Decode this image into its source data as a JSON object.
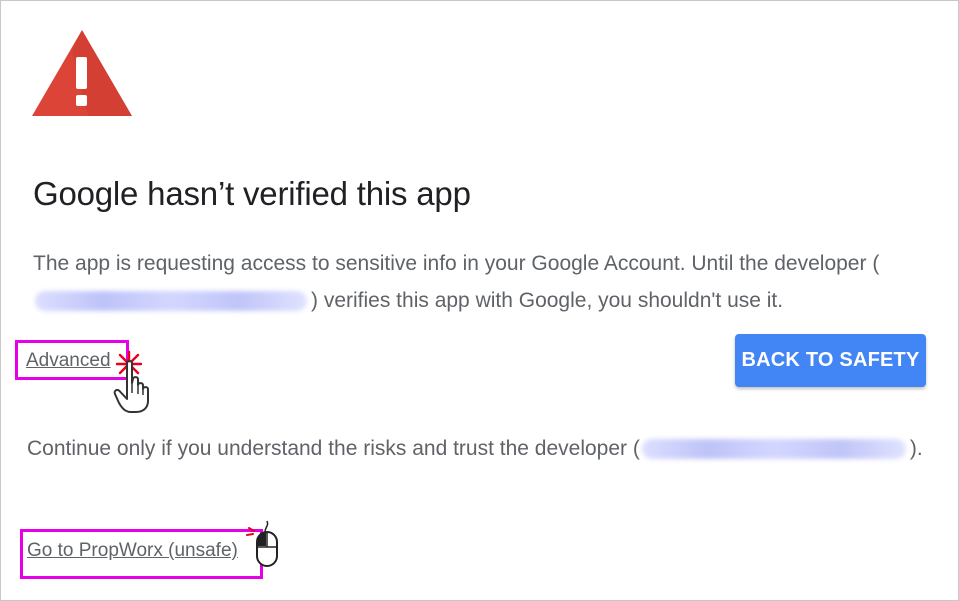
{
  "dialog": {
    "title": "Google hasn’t verified this app",
    "description_before": "The app is requesting access to sensitive info in your Google Account. Until the developer (",
    "description_after": ") verifies this app with Google, you shouldn't use it.",
    "advanced_link": "Advanced",
    "back_button": "BACK TO SAFETY",
    "continue_before": "Continue only if you understand the risks and trust the developer (",
    "continue_after": ").",
    "goto_link": "Go to PropWorx (unsafe)"
  },
  "icons": {
    "warning": "warning-triangle-icon",
    "hand_cursor": "hand-pointer-icon",
    "click_burst": "click-burst-icon",
    "mouse": "mouse-icon"
  },
  "colors": {
    "warning_red": "#db4437",
    "button_blue": "#4285f4",
    "highlight_magenta": "#e600e6",
    "text_gray": "#5f6368"
  }
}
